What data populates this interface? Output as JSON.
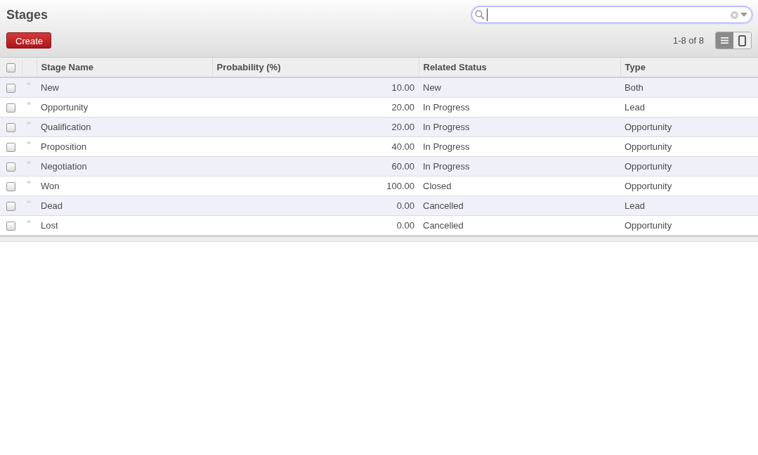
{
  "title": "Stages",
  "create_button": "Create",
  "pager": "1-8 of 8",
  "views": [
    {
      "kind": "list",
      "selected": true
    },
    {
      "kind": "kanban",
      "selected": false
    }
  ],
  "table": {
    "columns": [
      "Stage Name",
      "Probability (%)",
      "Related Status",
      "Type"
    ],
    "all_checked": false,
    "rows": [
      {
        "checked": false,
        "cells": [
          "New",
          "10.00",
          "New",
          "Both"
        ]
      },
      {
        "checked": false,
        "cells": [
          "Opportunity",
          "20.00",
          "In Progress",
          "Lead"
        ]
      },
      {
        "checked": false,
        "cells": [
          "Qualification",
          "20.00",
          "In Progress",
          "Opportunity"
        ]
      },
      {
        "checked": false,
        "cells": [
          "Proposition",
          "40.00",
          "In Progress",
          "Opportunity"
        ]
      },
      {
        "checked": false,
        "cells": [
          "Negotiation",
          "60.00",
          "In Progress",
          "Opportunity"
        ]
      },
      {
        "checked": false,
        "cells": [
          "Won",
          "100.00",
          "Closed",
          "Opportunity"
        ]
      },
      {
        "checked": false,
        "cells": [
          "Dead",
          "0.00",
          "Cancelled",
          "Lead"
        ]
      },
      {
        "checked": false,
        "cells": [
          "Lost",
          "0.00",
          "Cancelled",
          "Opportunity"
        ]
      }
    ]
  }
}
